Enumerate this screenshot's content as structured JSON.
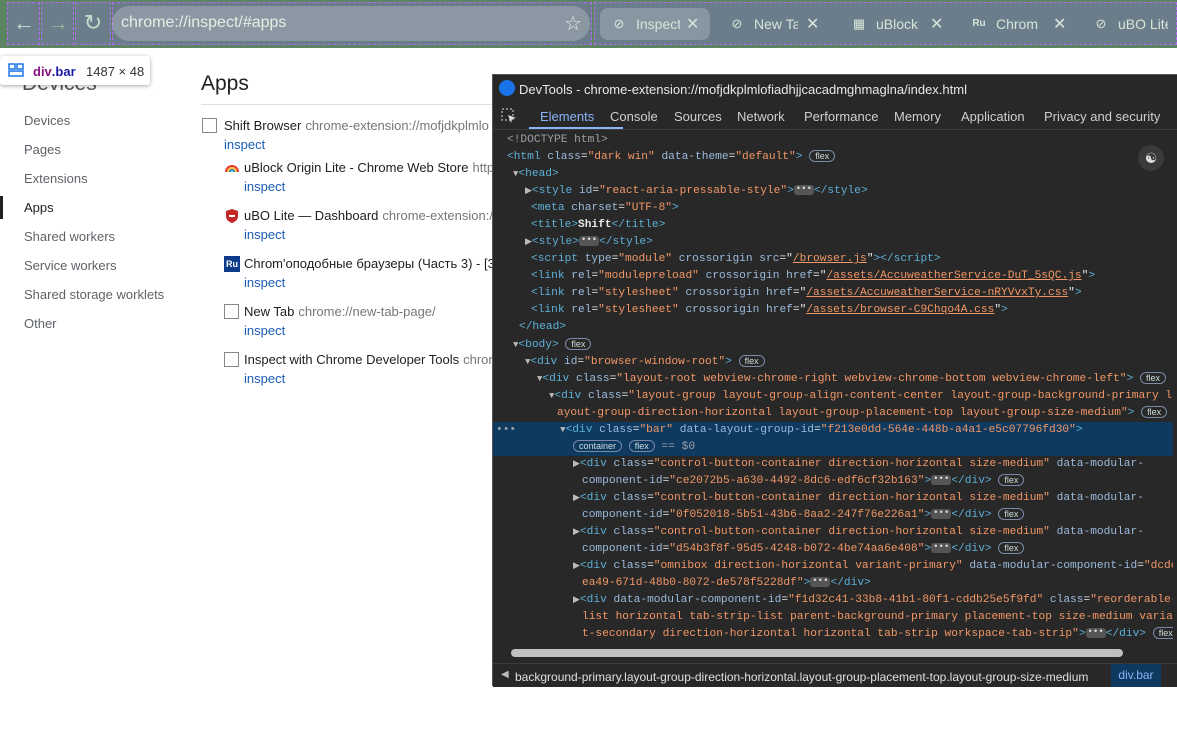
{
  "browser": {
    "url": "chrome://inspect/#apps",
    "tabs": [
      {
        "title": "Inspect",
        "icon": "chrome-icon"
      },
      {
        "title": "New Ta",
        "icon": "chrome-icon"
      },
      {
        "title": "uBlock",
        "icon": "ublock-icon"
      },
      {
        "title": "Chrom",
        "icon": "ru-icon"
      },
      {
        "title": "uBO Lite",
        "icon": "chrome-icon"
      }
    ],
    "colors": {
      "bar": "#5a8560",
      "highlight": "#8c6edc"
    }
  },
  "tooltip": {
    "tag": "div",
    "cls": ".bar",
    "dims": "1487 × 48"
  },
  "sidebar": {
    "header": "Devices",
    "items": [
      "Devices",
      "Pages",
      "Extensions",
      "Apps",
      "Shared workers",
      "Service workers",
      "Shared storage worklets",
      "Other"
    ]
  },
  "apps": {
    "title": "Apps",
    "list": [
      {
        "name": "Shift Browser",
        "url": "chrome-extension://mofjdkplmlo",
        "action": "inspect"
      },
      {
        "name": "uBlock Origin Lite - Chrome Web Store",
        "url": "http",
        "action": "inspect"
      },
      {
        "name": "uBO Lite — Dashboard",
        "url": "chrome-extension:/",
        "action": "inspect"
      },
      {
        "name": "Chrom'оподобные браузеры (Часть 3) - [3",
        "url": "",
        "action": "inspect"
      },
      {
        "name": "New Tab",
        "url": "chrome://new-tab-page/",
        "action": "inspect"
      },
      {
        "name": "Inspect with Chrome Developer Tools",
        "url": "chror",
        "action": "inspect"
      }
    ]
  },
  "devtools": {
    "title": "DevTools - chrome-extension://mofjdkplmlofiadhjjcacadmghmaglna/index.html",
    "tabs": [
      "Elements",
      "Console",
      "Sources",
      "Network",
      "Performance",
      "Memory",
      "Application",
      "Privacy and security"
    ],
    "dom": {
      "doctype": "<!DOCTYPE html>",
      "html_class": "\"dark win\"",
      "html_theme": "\"default\"",
      "style_id": "\"react-aria-pressable-style\"",
      "charset": "\"UTF-8\"",
      "title_text": "Shift",
      "script_type": "\"module\"",
      "script_src": "/browser.js",
      "link1_rel": "\"modulepreload\"",
      "link1_href": "/assets/AccuweatherService-DuT_5sQC.js",
      "link2_rel": "\"stylesheet\"",
      "link2_href": "/assets/AccuweatherService-nRYVvxTy.css",
      "link3_rel": "\"stylesheet\"",
      "link3_href": "/assets/browser-C9Chqo4A.css",
      "root_id": "\"browser-window-root\"",
      "layout_root_class": "\"layout-root webview-chrome-right webview-chrome-bottom webview-chrome-left\"",
      "layout_group_class_a": "\"layout-group layout-group-align-content-center layout-group-background-primary l",
      "layout_group_class_b": "ayout-group-direction-horizontal layout-group-placement-top layout-group-size-medium\"",
      "bar_class": "\"bar\"",
      "bar_group_id": "\"f213e0dd-564e-448b-a4a1-e5c07796fd30\"",
      "sel_var": "== $0",
      "cbc_class": "\"control-button-container direction-horizontal size-medium\"",
      "cbc_id1": "\"ce2072b5-a630-4492-8dc6-edf6cf32b163\"",
      "cbc_id2": "\"0f052018-5b51-43b6-8aa2-247f76e226a1\"",
      "cbc_id3": "\"d54b3f8f-95d5-4248-b072-4be74aa6e408\"",
      "omni_class": "\"omnibox direction-horizontal variant-primary\"",
      "omni_id_a": "\"dcde",
      "omni_id_b": "ea49-671d-48b0-8072-de578f5228df\"",
      "tabstrip_id": "\"f1d32c41-33b8-41b1-80f1-cddb25e5f9fd\"",
      "tabstrip_class_a": "\"reorderable-",
      "tabstrip_class_b": "list horizontal tab-strip-list parent-background-primary placement-top size-medium varian",
      "tabstrip_class_c": "t-secondary direction-horizontal horizontal tab-strip workspace-tab-strip\"",
      "badge_flex": "flex",
      "badge_container": "container"
    },
    "breadcrumb": {
      "path": "background-primary.layout-group-direction-horizontal.layout-group-placement-top.layout-group-size-medium",
      "current": "div.bar"
    }
  }
}
